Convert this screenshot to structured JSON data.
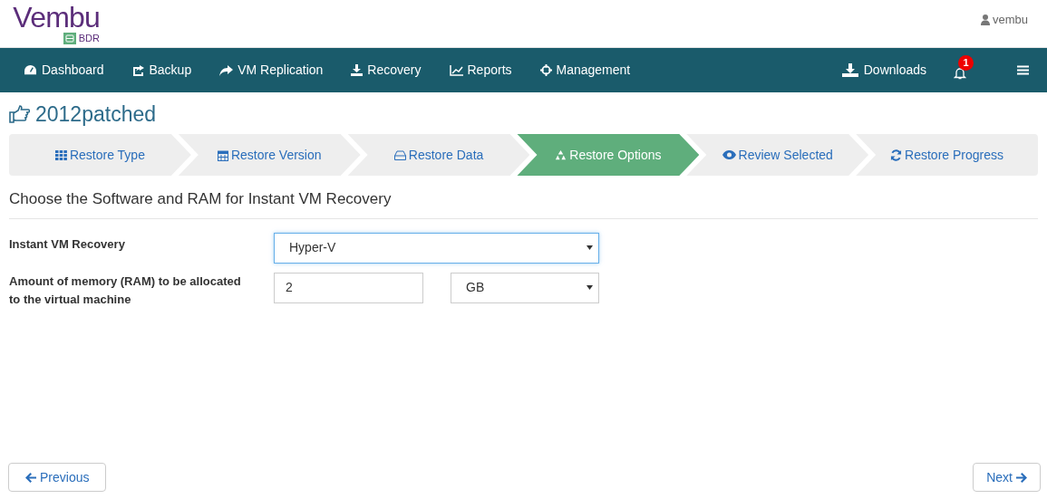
{
  "brand": {
    "name": "Vembu",
    "product": "BDR"
  },
  "user": {
    "name": "vembu"
  },
  "nav": [
    {
      "label": "Dashboard"
    },
    {
      "label": "Backup"
    },
    {
      "label": "VM Replication"
    },
    {
      "label": "Recovery"
    },
    {
      "label": "Reports"
    },
    {
      "label": "Management"
    }
  ],
  "nav_right": {
    "downloads": "Downloads",
    "notifications": "1"
  },
  "page_title": "2012patched",
  "steps": [
    {
      "label": "Restore Type",
      "selected": false
    },
    {
      "label": "Restore Version",
      "selected": false
    },
    {
      "label": "Restore Data",
      "selected": false
    },
    {
      "label": "Restore Options",
      "selected": true
    },
    {
      "label": "Review Selected",
      "selected": false
    },
    {
      "label": "Restore Progress",
      "selected": false
    }
  ],
  "section_title": "Choose the Software and RAM for Instant VM Recovery",
  "form": {
    "software": {
      "label": "Instant VM Recovery",
      "value": "Hyper-V",
      "focused": true
    },
    "memory": {
      "label": "Amount of memory (RAM) to be allocated to the virtual machine",
      "value": "2",
      "unit": "GB"
    }
  },
  "buttons": {
    "previous": "Previous",
    "next": "Next"
  }
}
